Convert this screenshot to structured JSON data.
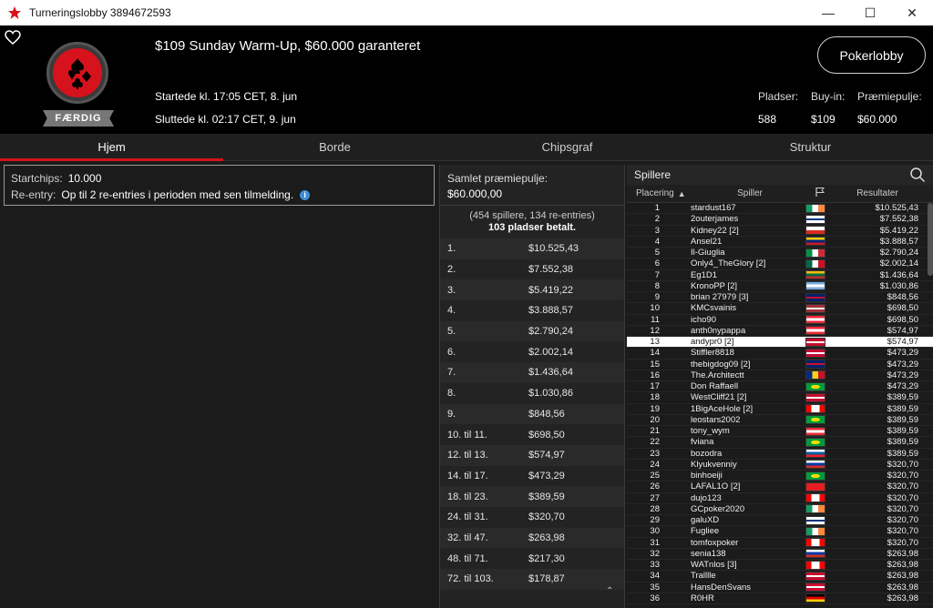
{
  "window": {
    "title": "Turneringslobby 3894672593"
  },
  "header": {
    "tourney_name": "$109 Sunday Warm-Up, $60.000 garanteret",
    "started": "Startede kl. 17:05 CET, 8. jun",
    "ended": "Sluttede kl. 02:17 CET, 9. jun",
    "status": "FÆRDIG",
    "lobby_button": "Pokerlobby",
    "stats": [
      {
        "label": "Pladser:",
        "value": "588"
      },
      {
        "label": "Buy-in:",
        "value": "$109"
      },
      {
        "label": "Præmiepulje:",
        "value": "$60.000"
      }
    ]
  },
  "tabs": [
    "Hjem",
    "Borde",
    "Chipsgraf",
    "Struktur"
  ],
  "info": {
    "startchips_label": "Startchips:",
    "startchips_value": "10.000",
    "reentry_label": "Re-entry:",
    "reentry_value": "Op til 2 re-entries i perioden med sen tilmelding."
  },
  "payouts": {
    "pool_label": "Samlet præmiepulje:",
    "pool_value": "$60.000,00",
    "entries": "(454 spillere, 134 re-entries)",
    "paid": "103 pladser betalt.",
    "rows": [
      {
        "place": "1.",
        "amount": "$10.525,43"
      },
      {
        "place": "2.",
        "amount": "$7.552,38"
      },
      {
        "place": "3.",
        "amount": "$5.419,22"
      },
      {
        "place": "4.",
        "amount": "$3.888,57"
      },
      {
        "place": "5.",
        "amount": "$2.790,24"
      },
      {
        "place": "6.",
        "amount": "$2.002,14"
      },
      {
        "place": "7.",
        "amount": "$1.436,64"
      },
      {
        "place": "8.",
        "amount": "$1.030,86"
      },
      {
        "place": "9.",
        "amount": "$848,56"
      },
      {
        "place": "10. til 11.",
        "amount": "$698,50"
      },
      {
        "place": "12. til 13.",
        "amount": "$574,97"
      },
      {
        "place": "14. til 17.",
        "amount": "$473,29"
      },
      {
        "place": "18. til 23.",
        "amount": "$389,59"
      },
      {
        "place": "24. til 31.",
        "amount": "$320,70"
      },
      {
        "place": "32. til 47.",
        "amount": "$263,98"
      },
      {
        "place": "48. til 71.",
        "amount": "$217,30"
      },
      {
        "place": "72. til 103.",
        "amount": "$178,87"
      }
    ]
  },
  "players": {
    "title": "Spillere",
    "col_place": "Placering",
    "col_player": "Spiller",
    "col_result": "Resultater",
    "rows": [
      {
        "rank": "1",
        "name": "stardust167",
        "flag": "ie",
        "result": "$10.525,43"
      },
      {
        "rank": "2",
        "name": "2outerjames",
        "flag": "fi",
        "result": "$7.552,38"
      },
      {
        "rank": "3",
        "name": "Kidney22 [2]",
        "flag": "cl",
        "result": "$5.419,22"
      },
      {
        "rank": "4",
        "name": "Ansel21",
        "flag": "ve",
        "result": "$3.888,57"
      },
      {
        "rank": "5",
        "name": "Il-Giuglia",
        "flag": "it",
        "result": "$2.790,24"
      },
      {
        "rank": "6",
        "name": "Only4_TheGlory [2]",
        "flag": "mx",
        "result": "$2.002,14"
      },
      {
        "rank": "7",
        "name": "Eg1D1",
        "flag": "lt",
        "result": "$1.436,64"
      },
      {
        "rank": "8",
        "name": "KronoPP [2]",
        "flag": "ar",
        "result": "$1.030,86"
      },
      {
        "rank": "9",
        "name": "brian 27979 [3]",
        "flag": "gb",
        "result": "$848,56"
      },
      {
        "rank": "10",
        "name": "KMCsvainis",
        "flag": "lv",
        "result": "$698,50"
      },
      {
        "rank": "11",
        "name": "icho90",
        "flag": "at",
        "result": "$698,50"
      },
      {
        "rank": "12",
        "name": "anth0nypappa",
        "flag": "at",
        "result": "$574,97"
      },
      {
        "rank": "13",
        "name": "andypr0 [2]",
        "flag": "dk",
        "result": "$574,97"
      },
      {
        "rank": "14",
        "name": "Stiffler8818",
        "flag": "dk",
        "result": "$473,29"
      },
      {
        "rank": "15",
        "name": "thebigdog09 [2]",
        "flag": "gb",
        "result": "$473,29"
      },
      {
        "rank": "16",
        "name": "The.Architectt",
        "flag": "ro",
        "result": "$473,29"
      },
      {
        "rank": "17",
        "name": "Don Raffaell",
        "flag": "br",
        "result": "$473,29"
      },
      {
        "rank": "18",
        "name": "WestCliff21 [2]",
        "flag": "dk",
        "result": "$389,59"
      },
      {
        "rank": "19",
        "name": "1BigAceHole [2]",
        "flag": "ca",
        "result": "$389,59"
      },
      {
        "rank": "20",
        "name": "leostars2002",
        "flag": "br",
        "result": "$389,59"
      },
      {
        "rank": "21",
        "name": "tony_wym",
        "flag": "at",
        "result": "$389,59"
      },
      {
        "rank": "22",
        "name": "fviana",
        "flag": "br",
        "result": "$389,59"
      },
      {
        "rank": "23",
        "name": "bozodra",
        "flag": "si",
        "result": "$389,59"
      },
      {
        "rank": "24",
        "name": "Klyukvenniy",
        "flag": "ru",
        "result": "$320,70"
      },
      {
        "rank": "25",
        "name": "binhoeiji",
        "flag": "br",
        "result": "$320,70"
      },
      {
        "rank": "26",
        "name": "LAFAL1O [2]",
        "flag": "al",
        "result": "$320,70"
      },
      {
        "rank": "27",
        "name": "dujo123",
        "flag": "ca",
        "result": "$320,70"
      },
      {
        "rank": "28",
        "name": "GCpoker2020",
        "flag": "ie",
        "result": "$320,70"
      },
      {
        "rank": "29",
        "name": "galuXD",
        "flag": "fi",
        "result": "$320,70"
      },
      {
        "rank": "30",
        "name": "Fugliee",
        "flag": "ie",
        "result": "$320,70"
      },
      {
        "rank": "31",
        "name": "tomfoxpoker",
        "flag": "ca",
        "result": "$320,70"
      },
      {
        "rank": "32",
        "name": "senia138",
        "flag": "ru",
        "result": "$263,98"
      },
      {
        "rank": "33",
        "name": "WATnlos [3]",
        "flag": "ca",
        "result": "$263,98"
      },
      {
        "rank": "34",
        "name": "Tralllle",
        "flag": "dk",
        "result": "$263,98"
      },
      {
        "rank": "35",
        "name": "HansDenSvans",
        "flag": "dk",
        "result": "$263,98"
      },
      {
        "rank": "36",
        "name": "R0HR",
        "flag": "de",
        "result": "$263,98"
      }
    ],
    "highlight_rank": "13"
  },
  "colors": {
    "accent": "#d6121c",
    "background": "#1b1b1b",
    "header": "#000000"
  }
}
